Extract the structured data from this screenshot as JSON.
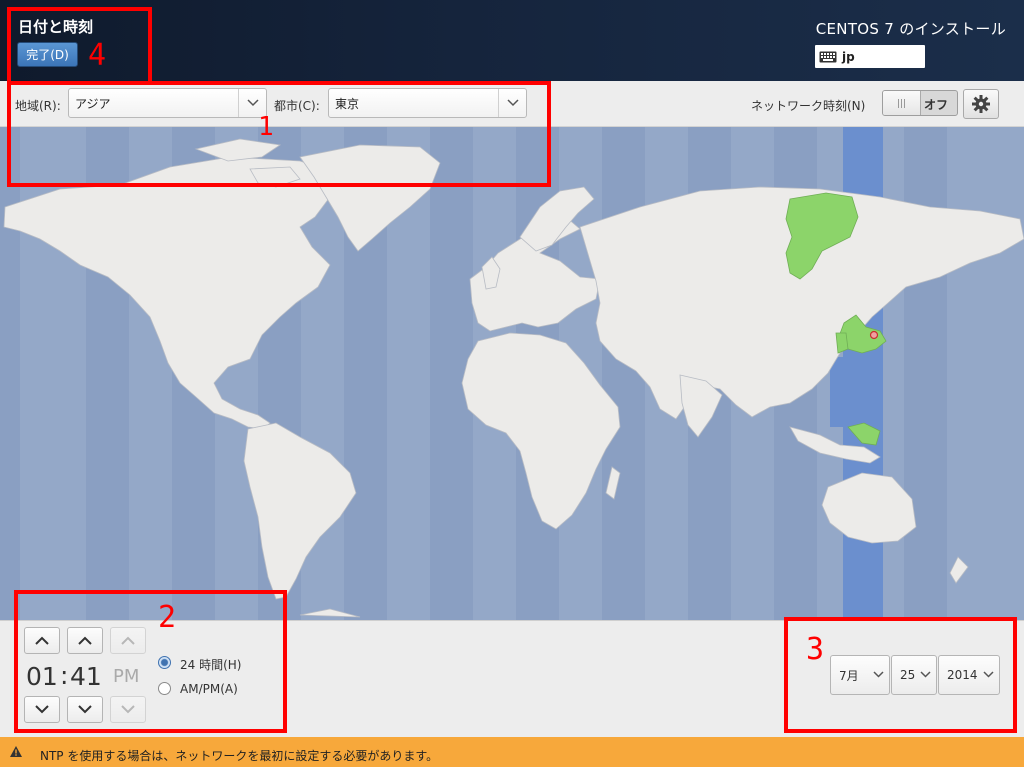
{
  "header": {
    "title": "日付と時刻",
    "done_label": "完了(D)",
    "installer_title": "CENTOS 7 のインストール",
    "keyboard_layout": "jp"
  },
  "selector": {
    "region_label": "地域(R):",
    "region_value": "アジア",
    "city_label": "都市(C):",
    "city_value": "東京",
    "network_time_label": "ネットワーク時刻(N)",
    "network_time_state": "オフ",
    "settings_icon": "gear-icon"
  },
  "time": {
    "hours": "01",
    "separator": ":",
    "minutes": "41",
    "ampm": "PM",
    "format_24h_label": "24 時間(H)",
    "format_ampm_label": "AM/PM(A)",
    "selected_format": "24h"
  },
  "date": {
    "month": "7月",
    "day": "25",
    "year": "2014"
  },
  "warning": {
    "icon": "warning-icon",
    "text": "NTP を使用する場合は、ネットワークを最初に設定する必要があります。"
  },
  "annotations": {
    "box_1": "1",
    "box_2": "2",
    "box_3": "3",
    "box_4": "4"
  },
  "colors": {
    "ocean": "#94a8c8",
    "land": "#ecebe9",
    "selected_zone": "#6b8fce",
    "highlight_country": "#8cd46a",
    "warning_bar": "#f7a83b",
    "annotation": "#ff0000"
  }
}
